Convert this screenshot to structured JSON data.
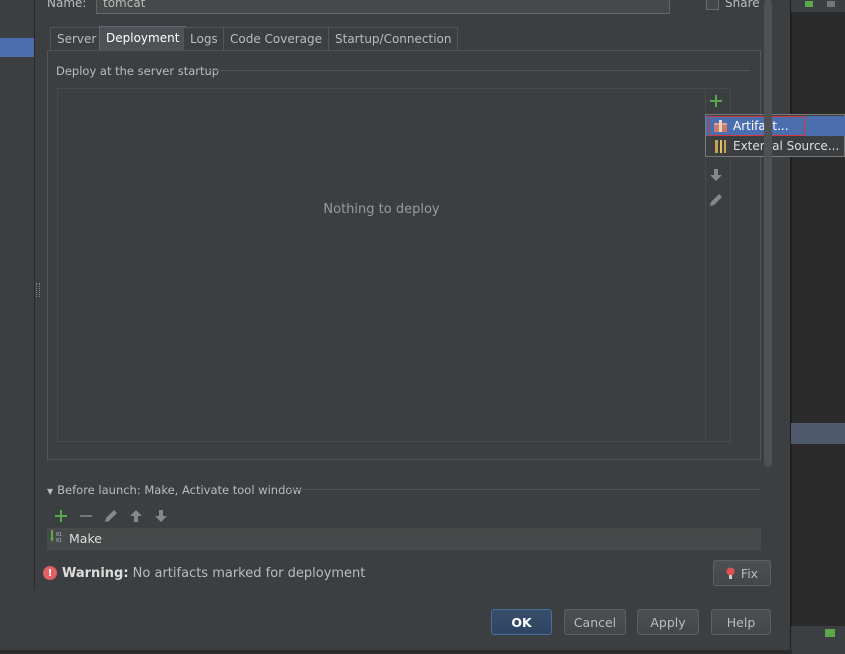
{
  "name_field": {
    "label": "Name:",
    "value": "tomcat"
  },
  "share": {
    "label": "Share",
    "checked": false
  },
  "tabs": [
    {
      "label": "Server",
      "active": false
    },
    {
      "label": "Deployment",
      "active": true
    },
    {
      "label": "Logs",
      "active": false
    },
    {
      "label": "Code Coverage",
      "active": false
    },
    {
      "label": "Startup/Connection",
      "active": false
    }
  ],
  "deploy": {
    "group_title": "Deploy at the server startup",
    "empty_text": "Nothing to deploy"
  },
  "popup_menu": {
    "items": [
      {
        "label": "Artifact...",
        "icon": "artifact-icon",
        "selected": true
      },
      {
        "label": "External Source...",
        "icon": "external-source-icon",
        "selected": false
      }
    ]
  },
  "before_launch": {
    "title": "Before launch: Make, Activate tool window",
    "items": [
      {
        "label": "Make",
        "icon": "make-icon"
      }
    ]
  },
  "warning": {
    "bold": "Warning:",
    "text": "No artifacts marked for deployment"
  },
  "buttons": {
    "fix": "Fix",
    "ok": "OK",
    "cancel": "Cancel",
    "apply": "Apply",
    "help": "Help"
  },
  "colors": {
    "background": "#3c3f41",
    "selection": "#4b6eaf",
    "add_green": "#59a84b",
    "error_red": "#e06064"
  }
}
